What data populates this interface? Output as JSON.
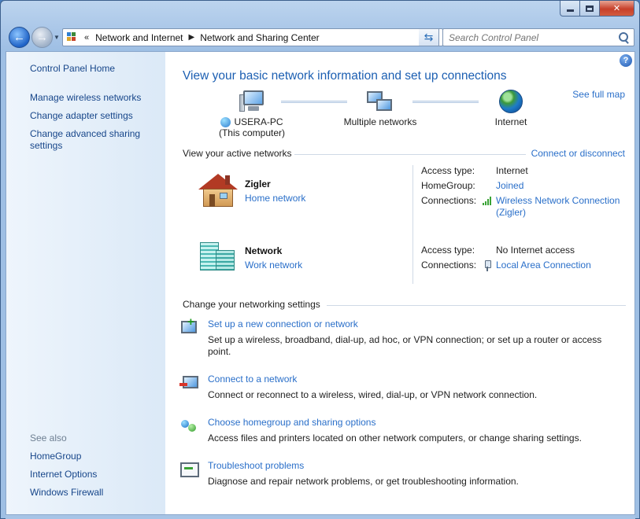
{
  "window": {
    "controls": {
      "minimize": "—",
      "maximize": "□",
      "close": "✕"
    }
  },
  "address": {
    "overflow": "«",
    "crumbs": [
      "Network and Internet",
      "Network and Sharing Center"
    ]
  },
  "search": {
    "placeholder": "Search Control Panel"
  },
  "sidebar": {
    "home": "Control Panel Home",
    "links": [
      "Manage wireless networks",
      "Change adapter settings",
      "Change advanced sharing settings"
    ],
    "see_also_title": "See also",
    "see_also": [
      "HomeGroup",
      "Internet Options",
      "Windows Firewall"
    ]
  },
  "main": {
    "help": "?",
    "heading": "View your basic network information and set up connections",
    "see_full_map": "See full map",
    "map": {
      "computer_name": "USERA-PC",
      "computer_sub": "(This computer)",
      "middle": "Multiple networks",
      "internet": "Internet"
    },
    "active_title": "View your active networks",
    "connect_disconnect": "Connect or disconnect",
    "networks": [
      {
        "name": "Zigler",
        "type": "Home network",
        "access_label": "Access type:",
        "access_value": "Internet",
        "homegroup_label": "HomeGroup:",
        "homegroup_value": "Joined",
        "connections_label": "Connections:",
        "connection": "Wireless Network Connection (Zigler)"
      },
      {
        "name": "Network",
        "type": "Work network",
        "access_label": "Access type:",
        "access_value": "No Internet access",
        "connections_label": "Connections:",
        "connection": "Local Area Connection"
      }
    ],
    "settings_title": "Change your networking settings",
    "tasks": [
      {
        "link": "Set up a new connection or network",
        "desc": "Set up a wireless, broadband, dial-up, ad hoc, or VPN connection; or set up a router or access point."
      },
      {
        "link": "Connect to a network",
        "desc": "Connect or reconnect to a wireless, wired, dial-up, or VPN network connection."
      },
      {
        "link": "Choose homegroup and sharing options",
        "desc": "Access files and printers located on other network computers, or change sharing settings."
      },
      {
        "link": "Troubleshoot problems",
        "desc": "Diagnose and repair network problems, or get troubleshooting information."
      }
    ]
  },
  "colors": {
    "link": "#2a6fc9",
    "heading": "#1c5fb2",
    "sidebar_link": "#17468a"
  }
}
